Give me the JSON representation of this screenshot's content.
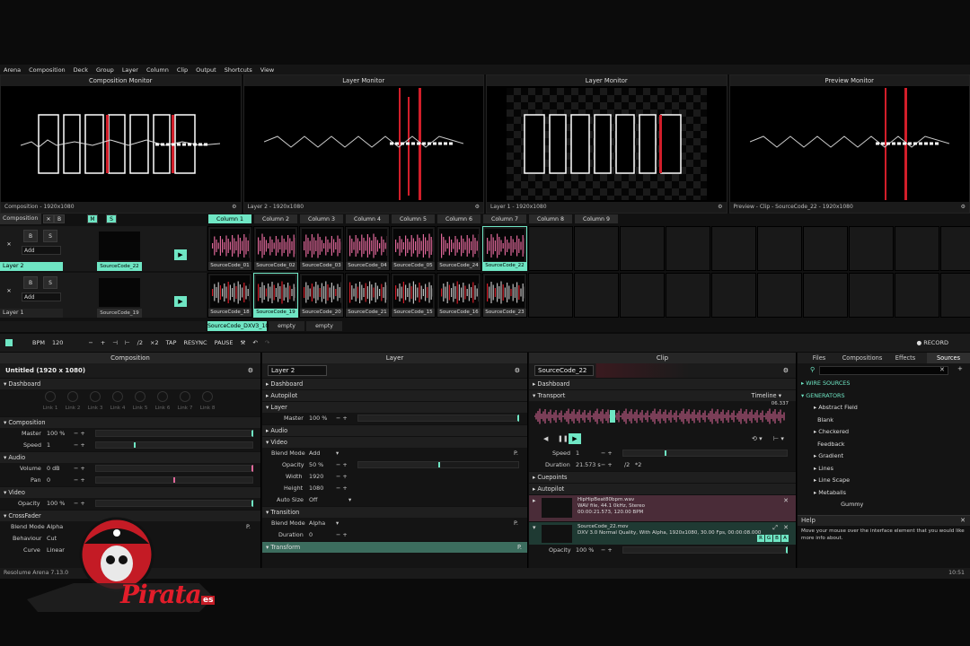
{
  "menu": [
    "Arena",
    "Composition",
    "Deck",
    "Group",
    "Layer",
    "Column",
    "Clip",
    "Output",
    "Shortcuts",
    "View"
  ],
  "monitors": [
    {
      "title": "Composition Monitor",
      "footer": "Composition - 1920x1080"
    },
    {
      "title": "Layer Monitor",
      "footer": "Layer 2 - 1920x1080"
    },
    {
      "title": "Layer Monitor",
      "footer": "Layer 1 - 1920x1080"
    },
    {
      "title": "Preview Monitor",
      "footer": "Preview - Clip - SourceCode_22 - 1920x1080"
    }
  ],
  "deck": {
    "composition_label": "Composition",
    "columns": [
      "Column 1",
      "Column 2",
      "Column 3",
      "Column 4",
      "Column 5",
      "Column 6",
      "Column 7",
      "Column 8",
      "Column 9"
    ],
    "layers": [
      {
        "name": "Layer 2",
        "blend": "Add",
        "current": "SourceCode_22",
        "clips": [
          "SourceCode_01",
          "SourceCode_02",
          "SourceCode_03",
          "SourceCode_04",
          "SourceCode_05",
          "SourceCode_24",
          "SourceCode_22"
        ]
      },
      {
        "name": "Layer 1",
        "blend": "Add",
        "current": "SourceCode_19",
        "clips": [
          "SourceCode_18",
          "SourceCode_19",
          "SourceCode_20",
          "SourceCode_21",
          "SourceCode_15",
          "SourceCode_16",
          "SourceCode_23"
        ]
      }
    ],
    "decks": [
      "SourceCode_DXV3_1080p",
      "empty",
      "empty"
    ]
  },
  "transport": {
    "bpm_label": "BPM",
    "bpm": "120",
    "div2": "/2",
    "mul2": "×2",
    "tap": "TAP",
    "resync": "RESYNC",
    "pause": "PAUSE",
    "record": "RECORD"
  },
  "composition_panel": {
    "title": "Composition",
    "subtitle": "Untitled (1920 x 1080)",
    "dashboard": "Dashboard",
    "links": [
      "Link 1",
      "Link 2",
      "Link 3",
      "Link 4",
      "Link 5",
      "Link 6",
      "Link 7",
      "Link 8"
    ],
    "composition_sec": "Composition",
    "master_label": "Master",
    "master_val": "100 %",
    "speed_label": "Speed",
    "speed_val": "1",
    "audio_sec": "Audio",
    "volume_label": "Volume",
    "volume_val": "0 dB",
    "pan_label": "Pan",
    "pan_val": "0",
    "video_sec": "Video",
    "opacity_label": "Opacity",
    "opacity_val": "100 %",
    "crossfader_sec": "CrossFader",
    "blend_label": "Blend Mode",
    "blend_val": "Alpha",
    "behaviour_label": "Behaviour",
    "behaviour_val": "Cut",
    "curve_label": "Curve",
    "curve_val": "Linear"
  },
  "layer_panel": {
    "title": "Layer",
    "name": "Layer 2",
    "dashboard": "Dashboard",
    "autopilot": "Autopilot",
    "layer_sec": "Layer",
    "master_label": "Master",
    "master_val": "100 %",
    "audio_sec": "Audio",
    "video_sec": "Video",
    "blend_label": "Blend Mode",
    "blend_val": "Add",
    "opacity_label": "Opacity",
    "opacity_val": "50 %",
    "width_label": "Width",
    "width_val": "1920",
    "height_label": "Height",
    "height_val": "1080",
    "autosize_label": "Auto Size",
    "autosize_val": "Off",
    "transition_sec": "Transition",
    "tblend_label": "Blend Mode",
    "tblend_val": "Alpha",
    "duration_label": "Duration",
    "duration_val": "0",
    "transform_sec": "Transform"
  },
  "clip_panel": {
    "title": "Clip",
    "name": "SourceCode_22",
    "dashboard": "Dashboard",
    "transport_sec": "Transport",
    "timeline": "Timeline",
    "time": "06.337",
    "speed_label": "Speed",
    "speed_val": "1",
    "duration_label": "Duration",
    "duration_val": "21.573 s",
    "div": "/2",
    "mul": "*2",
    "cuepoints": "Cuepoints",
    "autopilot": "Autopilot",
    "audio_file": "HipHipBeat80bpm.wav",
    "audio_meta1": "WAV file, 44.1 0kHz, Stereo",
    "audio_meta2": "00:00:21.573, 120.00 BPM",
    "video_file": "SourceCode_22.mov",
    "video_meta": "DXV 3.0 Normal Quality, With Alpha, 1920x1080, 30.00 Fps, 00:00:08.000",
    "rgba": [
      "R",
      "G",
      "B",
      "A"
    ],
    "opacity_label": "Opacity",
    "opacity_val": "100 %"
  },
  "browser": {
    "tabs": [
      "Files",
      "Compositions",
      "Effects",
      "Sources"
    ],
    "wire": "WIRE SOURCES",
    "generators": "GENERATORS",
    "items": [
      "Abstract Field",
      "Blank",
      "Checkered",
      "Feedback",
      "Gradient",
      "Lines",
      "Line Scape",
      "Metaballs",
      "Gummy"
    ],
    "help_title": "Help",
    "help_text": "Move your mouse over the interface element that you would like more info about."
  },
  "status": {
    "version": "Resolume Arena 7.13.0",
    "clock": "10:51"
  },
  "logo": {
    "text": "Pirata",
    "suffix": "es"
  },
  "colors": {
    "accent": "#6fe6c4",
    "pink": "#e0689a",
    "red": "#d21e2a"
  }
}
